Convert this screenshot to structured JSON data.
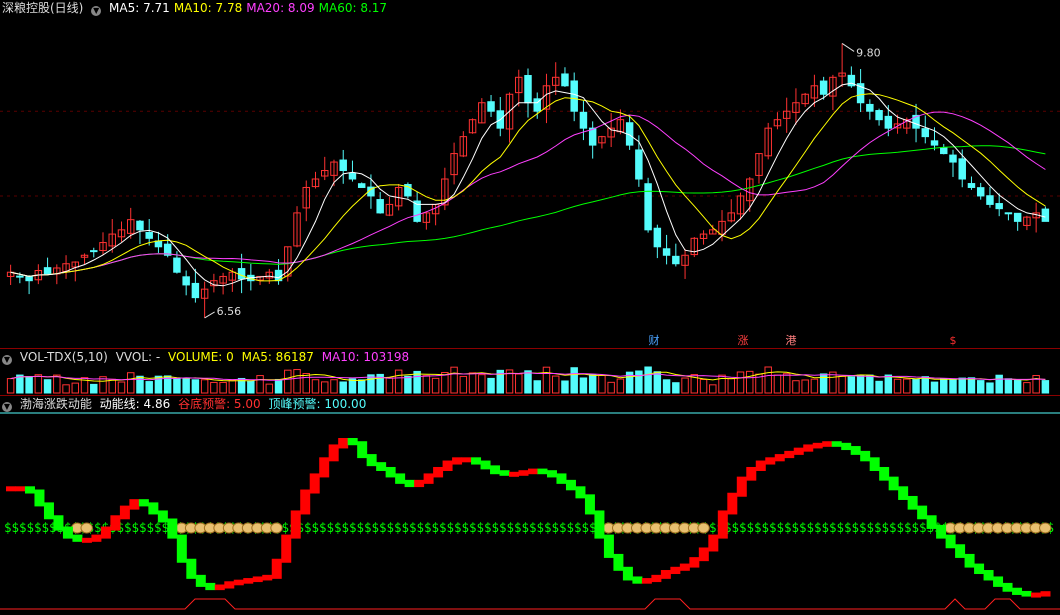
{
  "main": {
    "stock_name": "深粮控股(日线)",
    "ma_items": [
      {
        "label": "MA5: 7.71",
        "color": "#ffffff"
      },
      {
        "label": "MA10: 7.78",
        "color": "#ffff00"
      },
      {
        "label": "MA20: 8.09",
        "color": "#ff40ff"
      },
      {
        "label": "MA60: 8.17",
        "color": "#00ff00"
      }
    ],
    "high_label": "9.80",
    "low_label": "6.56",
    "markers": [
      {
        "text": "财",
        "color": "#4aa3ff"
      },
      {
        "text": "涨",
        "color": "#ff4040"
      },
      {
        "text": "港",
        "color": "#ff8080"
      },
      {
        "text": "$",
        "color": "#ff3030"
      }
    ]
  },
  "volume": {
    "indicator": "VOL-TDX(5,10)",
    "vvol": "VVOL: -",
    "volume": "VOLUME: 0",
    "ma5": "MA5: 86187",
    "ma10": "MA10: 103198"
  },
  "momentum": {
    "name": "渤海涨跌动能",
    "line": "动能线: 4.86",
    "bottom_warn": "谷底预警: 5.00",
    "top_warn": "顶峰预警: 100.00",
    "s_glyph": "$"
  },
  "colors": {
    "up": "#ff3232",
    "down": "#54fcfc",
    "ma5": "#ffffff",
    "ma10": "#ffff00",
    "ma20": "#ff40ff",
    "ma60": "#00ff00",
    "momentum_up": "#ff0000",
    "momentum_down": "#00ff00"
  },
  "chart_data": [
    {
      "type": "candlestick",
      "title": "深粮控股(日线)",
      "ylim": [
        6.3,
        10.1
      ],
      "high": 9.8,
      "low": 6.56,
      "close_series": [
        7.1,
        7.05,
        7.0,
        7.12,
        7.08,
        7.15,
        7.2,
        7.22,
        7.3,
        7.35,
        7.45,
        7.55,
        7.6,
        7.72,
        7.6,
        7.5,
        7.4,
        7.3,
        7.1,
        6.95,
        6.8,
        6.9,
        7.0,
        7.05,
        7.1,
        7.02,
        7.0,
        7.05,
        7.1,
        7.0,
        7.4,
        7.8,
        8.1,
        8.2,
        8.3,
        8.4,
        8.3,
        8.2,
        8.1,
        8.0,
        7.8,
        7.9,
        8.1,
        8.0,
        7.7,
        7.8,
        7.9,
        8.2,
        8.5,
        8.7,
        8.9,
        9.1,
        9.0,
        8.8,
        9.2,
        9.4,
        9.1,
        9.0,
        9.3,
        9.4,
        9.3,
        9.0,
        8.8,
        8.6,
        8.7,
        8.8,
        8.9,
        8.6,
        8.2,
        7.6,
        7.4,
        7.3,
        7.2,
        7.3,
        7.5,
        7.55,
        7.6,
        7.7,
        7.8,
        8.0,
        8.2,
        8.5,
        8.8,
        8.9,
        9.0,
        9.1,
        9.2,
        9.3,
        9.2,
        9.4,
        9.45,
        9.3,
        9.1,
        9.0,
        8.9,
        8.8,
        8.85,
        8.9,
        8.8,
        8.7,
        8.6,
        8.5,
        8.4,
        8.2,
        8.1,
        8.0,
        7.9,
        7.85,
        7.8,
        7.7,
        7.75,
        7.8,
        7.7
      ],
      "ma_lines": [
        "MA5",
        "MA10",
        "MA20",
        "MA60"
      ]
    },
    {
      "type": "bar",
      "title": "VOL-TDX(5,10)",
      "ma5": 86187,
      "ma10": 103198
    },
    {
      "type": "line",
      "title": "渤海涨跌动能",
      "ylim": [
        0,
        100
      ],
      "bottom_warn": 5.0,
      "top_warn": 100.0,
      "current": 4.86,
      "values": [
        70,
        70,
        68,
        60,
        52,
        45,
        40,
        38,
        38,
        40,
        45,
        52,
        58,
        62,
        60,
        55,
        50,
        40,
        25,
        15,
        10,
        8,
        9,
        11,
        12,
        13,
        14,
        15,
        25,
        40,
        55,
        68,
        78,
        88,
        96,
        100,
        98,
        90,
        85,
        82,
        78,
        74,
        72,
        74,
        78,
        82,
        86,
        88,
        88,
        86,
        83,
        80,
        79,
        79,
        80,
        81,
        80,
        78,
        74,
        70,
        65,
        55,
        40,
        28,
        20,
        14,
        12,
        13,
        15,
        18,
        20,
        22,
        26,
        32,
        40,
        55,
        66,
        76,
        82,
        86,
        88,
        90,
        92,
        94,
        96,
        97,
        98,
        97,
        95,
        92,
        88,
        82,
        76,
        70,
        64,
        58,
        52,
        46,
        40,
        34,
        28,
        22,
        18,
        14,
        10,
        7,
        5,
        4,
        4,
        4.86
      ]
    }
  ]
}
